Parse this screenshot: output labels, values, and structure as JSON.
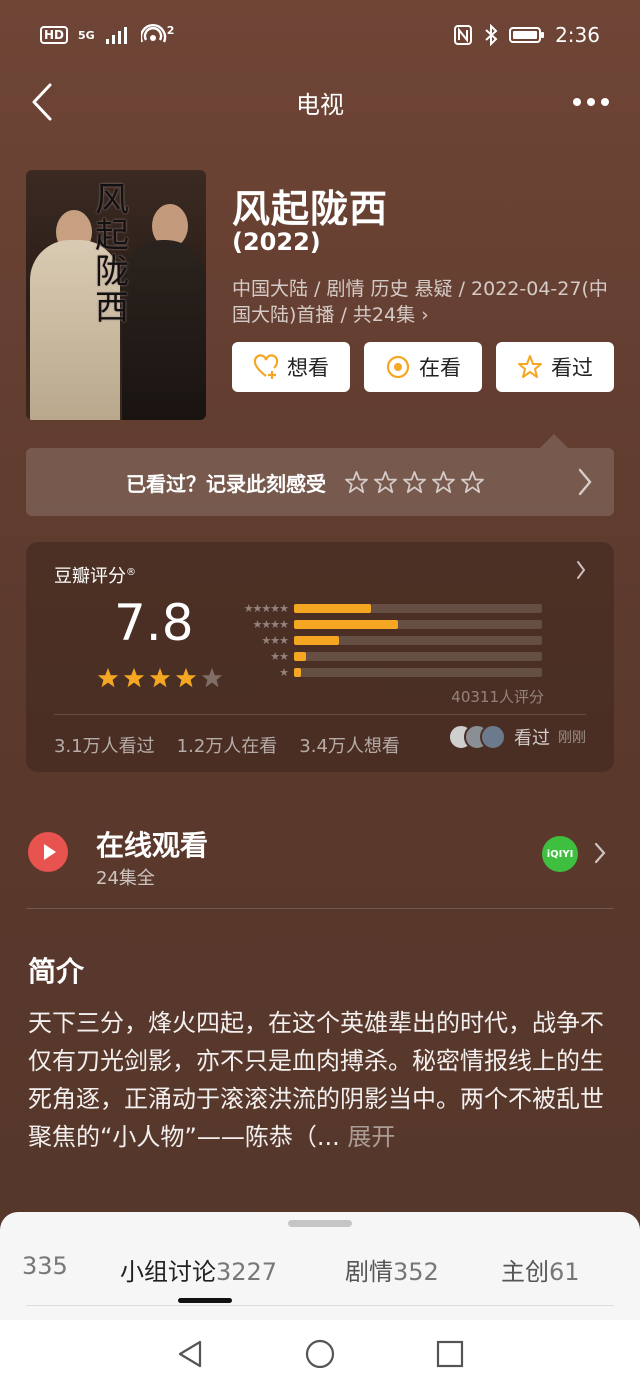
{
  "status_bar": {
    "hd": "HD",
    "network": "5G",
    "hotspot_count": "2",
    "time": "2:36"
  },
  "nav": {
    "title": "电视"
  },
  "movie": {
    "title": "风起陇西",
    "year": "(2022)",
    "meta": "中国大陆 / 剧情 历史 悬疑 / 2022-04-27(中国大陆)首播 / 共24集 ›",
    "poster_text": "风起陇西"
  },
  "actions": {
    "want": "想看",
    "watching": "在看",
    "watched": "看过"
  },
  "rate_prompt": {
    "text": "已看过？记录此刻感受"
  },
  "rating": {
    "label": "豆瓣评分",
    "reg": "®",
    "score": "7.8",
    "star_level": 4,
    "distribution": [
      {
        "stars": "★★★★★",
        "fraction": 0.31
      },
      {
        "stars": "★★★★",
        "fraction": 0.42
      },
      {
        "stars": "★★★",
        "fraction": 0.18
      },
      {
        "stars": "★★",
        "fraction": 0.05
      },
      {
        "stars": "★",
        "fraction": 0.03
      }
    ],
    "votes": "40311人评分",
    "watched_count": "3.1万人看过",
    "watching_count": "1.2万人在看",
    "want_count": "3.4万人想看",
    "friends_status": "看过",
    "friends_time": "刚刚"
  },
  "online": {
    "title": "在线观看",
    "subtitle": "24集全",
    "platform": "iQIYI"
  },
  "intro": {
    "title": "简介",
    "text": "天下三分，烽火四起，在这个英雄辈出的时代，战争不仅有刀光剑影，亦不只是血肉搏杀。秘密情报线上的生死角逐，正涌动于滚滚洪流的阴影当中。两个不被乱世聚焦的“小人物”——陈恭（...",
    "expand": "展开"
  },
  "tabs": [
    {
      "label": "",
      "count": "335"
    },
    {
      "label": "小组讨论",
      "count": "3227"
    },
    {
      "label": "剧情",
      "count": "352"
    },
    {
      "label": "主创",
      "count": "61"
    }
  ],
  "colors": {
    "background": "#5c3a2d",
    "star": "#f5a623",
    "play": "#e8524f",
    "iqiyi": "#3fbf3f"
  }
}
